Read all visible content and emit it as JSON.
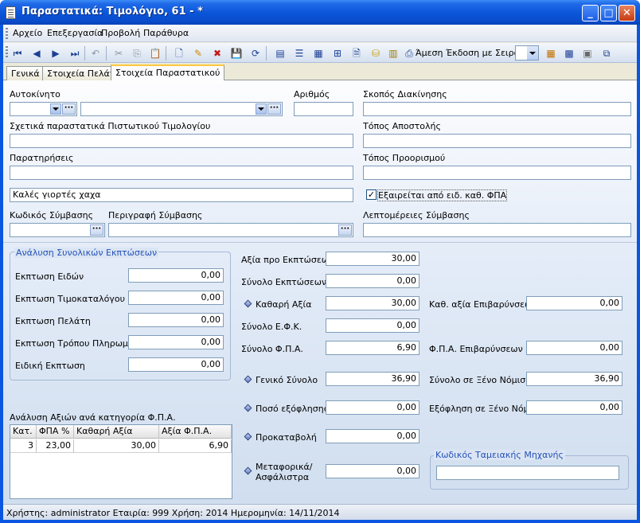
{
  "window": {
    "title": "Παραστατικά: Τιμολόγιο, 61  - *",
    "controls": [
      "_",
      "□",
      "✕"
    ]
  },
  "menu": [
    "Αρχείο",
    "Επεξεργασία",
    "Προβολή",
    "Παράθυρα"
  ],
  "toolbar": {
    "direct_issue_label": "Άμεση Έκδοση με Σειρά:",
    "direct_issue_value": ""
  },
  "tabs": [
    {
      "label": "Γενικά",
      "active": false
    },
    {
      "label": "Στοιχεία Πελάτη",
      "active": false
    },
    {
      "label": "Στοιχεία Παραστατικού",
      "active": true
    }
  ],
  "form": {
    "vehicle_label": "Αυτοκίνητο",
    "vehicle_code": "",
    "vehicle_name": "",
    "number_label": "Αριθμός",
    "number_value": "",
    "purpose_label": "Σκοπός Διακίνησης",
    "purpose_value": "",
    "related_label": "Σχετικά παραστατικά Πιστωτικού Τιμολογίου",
    "related_value": "",
    "dispatch_place_label": "Τόπος Αποστολής",
    "dispatch_place_value": "",
    "remarks_label": "Παρατηρήσεις",
    "remarks_value": "",
    "destination_label": "Τόπος Προορισμού",
    "destination_value": "",
    "remarks2_value": "Καλές γιορτές χαχα",
    "vat_exempt_label": "Εξαιρείται από ειδ. καθ. ΦΠΑ",
    "vat_exempt_checked": true,
    "contract_code_label": "Κωδικός Σύμβασης",
    "contract_code_value": "",
    "contract_desc_label": "Περιγραφή Σύμβασης",
    "contract_desc_value": "",
    "contract_details_label": "Λεπτομέρειες Σύμβασης",
    "contract_details_value": ""
  },
  "discounts": {
    "title": "Ανάλυση Συνολικών Εκπτώσεων",
    "rows": [
      {
        "label": "Εκπτωση Ειδών",
        "value": "0,00"
      },
      {
        "label": "Εκπτωση Τιμοκαταλόγου",
        "value": "0,00"
      },
      {
        "label": "Εκπτωση Πελάτη",
        "value": "0,00"
      },
      {
        "label": "Εκπτωση Τρόπου Πληρωμής",
        "value": "0,00"
      },
      {
        "label": "Ειδική Εκπτωση",
        "value": "0,00"
      }
    ]
  },
  "vat_analysis": {
    "title": "Ανάλυση Αξιών ανά κατηγορία Φ.Π.Α.",
    "columns": [
      "Κατ.",
      "ΦΠΑ %",
      "Καθαρή Αξία",
      "Αξία Φ.Π.Α."
    ],
    "rows": [
      [
        "3",
        "23,00",
        "30,00",
        "6,90"
      ]
    ]
  },
  "totals": {
    "value_before_disc_label": "Αξία προ Εκπτώσεων",
    "value_before_disc": "30,00",
    "total_disc_label": "Σύνολο Εκπτώσεων",
    "total_disc": "0,00",
    "net_value_label": "Καθαρή Αξία",
    "net_value": "30,00",
    "efk_label": "Σύνολο Ε.Φ.Κ.",
    "efk": "0,00",
    "vat_total_label": "Σύνολο Φ.Π.Α.",
    "vat_total": "6,90",
    "grand_total_label": "Γενικό Σύνολο",
    "grand_total": "36,90",
    "paid_label": "Ποσό εξόφλησης",
    "paid": "0,00",
    "advance_label": "Προκαταβολή",
    "advance": "0,00",
    "freight_label_1": "Μεταφορικά/",
    "freight_label_2": "Ασφάλιστρα",
    "freight": "0,00",
    "net_surcharges_label": "Καθ. αξία Επιβαρύνσεων",
    "net_surcharges": "0,00",
    "vat_surcharges_label": "Φ.Π.Α. Επιβαρύνσεων",
    "vat_surcharges": "0,00",
    "foreign_total_label": "Σύνολο σε Ξένο Νόμισμα",
    "foreign_total": "36,90",
    "foreign_paid_label": "Εξόφληση σε Ξένο Νόμ.",
    "foreign_paid": "0,00"
  },
  "cash_register": {
    "title": "Κωδικός Ταμειακής Μηχανής",
    "value": ""
  },
  "status": {
    "text": "Χρήστης: administrator   Εταιρία: 999  Χρήση: 2014   Ημερομηνία: 14/11/2014"
  },
  "colors": {
    "titlebar": "#0a55d8",
    "group_title": "#2452b8",
    "active_tab_accent": "#ffc83c"
  },
  "icons": [
    "first-record-icon",
    "previous-record-icon",
    "next-record-icon",
    "last-record-icon",
    "undo-icon",
    "cut-icon",
    "copy-icon",
    "paste-icon",
    "new-document-icon",
    "edit-document-icon",
    "delete-icon",
    "save-icon",
    "refresh-icon",
    "form-icon",
    "list-icon",
    "grid-icon",
    "tree-icon",
    "document-icon",
    "coins-icon",
    "calculator-icon",
    "print-icon",
    "calendar-icon",
    "monitor-icon",
    "copy-page-icon"
  ]
}
